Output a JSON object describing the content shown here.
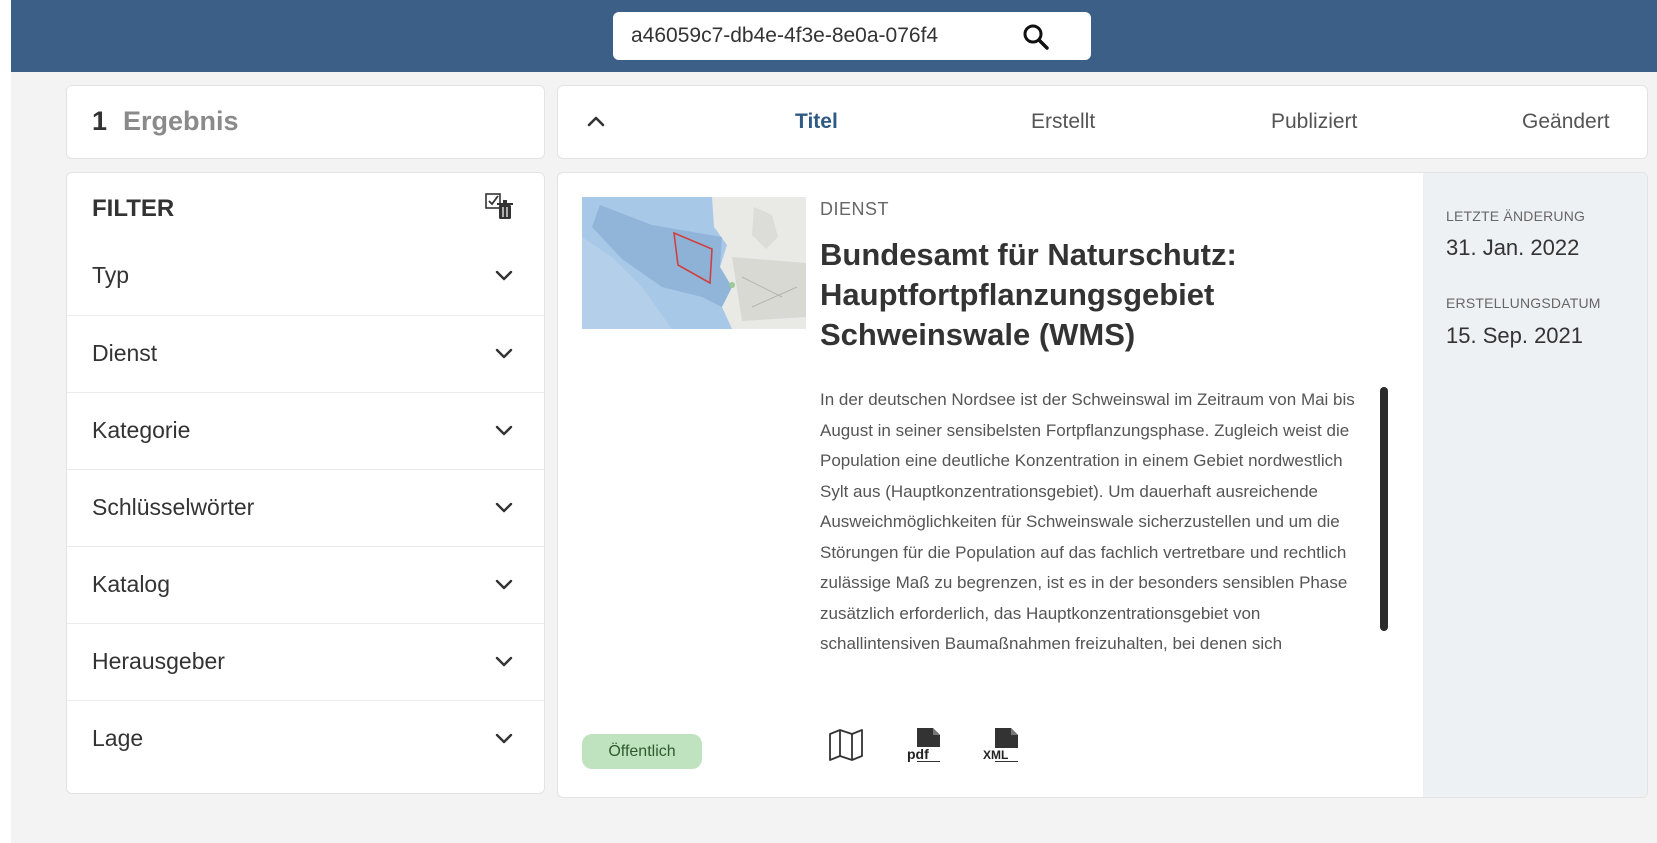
{
  "search": {
    "value": "a46059c7-db4e-4f3e-8e0a-076f4",
    "icon": "search-icon"
  },
  "results": {
    "count": "1",
    "label": "Ergebnis"
  },
  "sort": {
    "toggle_icon": "chevron-up-icon",
    "options": [
      "Titel",
      "Erstellt",
      "Publiziert",
      "Geändert"
    ],
    "active": "Titel"
  },
  "filter": {
    "title": "FILTER",
    "clear_icon": "clear-filter-icon",
    "items": [
      "Typ",
      "Dienst",
      "Kategorie",
      "Schlüsselwörter",
      "Katalog",
      "Herausgeber",
      "Lage"
    ]
  },
  "result": {
    "type": "DIENST",
    "title": "Bundesamt für Naturschutz: Hauptfortpflanzungsgebiet Schweinswale (WMS)",
    "description": "In der deutschen Nordsee ist der Schweinswal im Zeitraum von Mai bis August in seiner sensibelsten Fortpflanzungsphase. Zugleich weist die Population eine deutliche Konzentration in einem Gebiet nordwestlich Sylt aus (Hauptkonzentrationsgebiet). Um dauerhaft ausreichende Ausweichmöglichkeiten für Schweinswale sicherzustellen und um die Störungen für die Population auf das fachlich vertretbare und rechtlich zulässige Maß zu begrenzen, ist es in der besonders sensiblen Phase zusätzlich erforderlich, das Hauptkonzentrationsgebiet von schallintensiven Baumaßnahmen freizuhalten, bei denen sich",
    "badge": "Öffentlich",
    "icons": [
      "map-icon",
      "pdf-icon",
      "xml-icon"
    ],
    "meta": {
      "modified_label": "LETZTE ÄNDERUNG",
      "modified_value": "31. Jan. 2022",
      "created_label": "ERSTELLUNGSDATUM",
      "created_value": "15. Sep. 2021"
    }
  },
  "colors": {
    "header": "#3b5f86",
    "accent": "#2f5a83",
    "badge_bg": "#bfe3bf",
    "meta_bg": "#eef1f4"
  }
}
